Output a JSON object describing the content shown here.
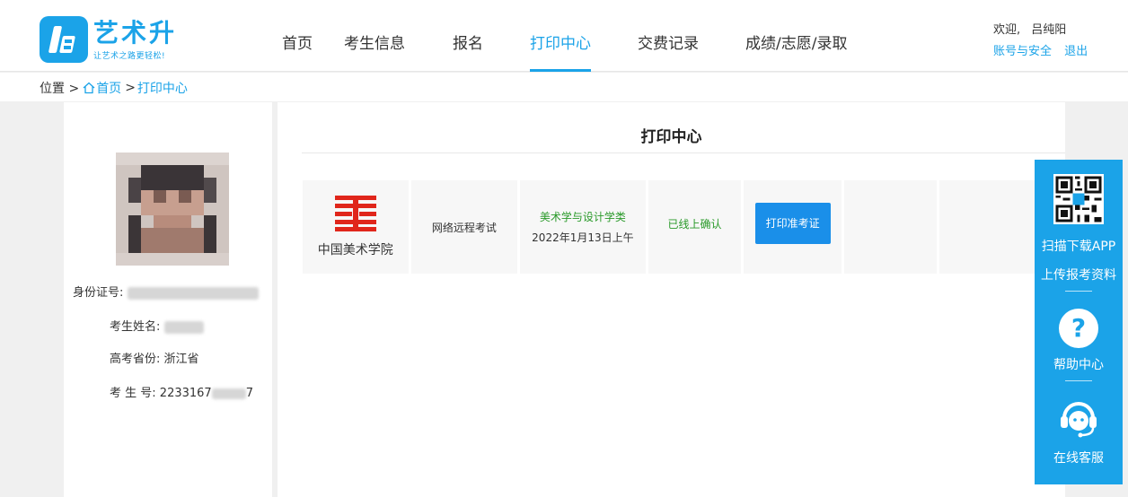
{
  "brand": {
    "name": "艺术升",
    "slogan": "让艺术之路更轻松!"
  },
  "nav": [
    {
      "label": "首页",
      "active": false
    },
    {
      "label": "考生信息",
      "active": false
    },
    {
      "label": "报名",
      "active": false
    },
    {
      "label": "打印中心",
      "active": true
    },
    {
      "label": "交费记录",
      "active": false
    },
    {
      "label": "成绩/志愿/录取",
      "active": false
    }
  ],
  "user": {
    "greeting": "欢迎,",
    "name": "吕纯阳",
    "account_link": "账号与安全",
    "logout_link": "退出"
  },
  "breadcrumb": {
    "prefix": "位置 >",
    "home": "首页",
    "separator": ">",
    "current": "打印中心"
  },
  "profile": {
    "id_label": "身份证号:",
    "name_label": "考生姓名:",
    "province_label": "高考省份:",
    "province": "浙江省",
    "exam_no_label": "考 生 号:",
    "exam_no_visible": "2233167",
    "exam_no_tail": "7"
  },
  "print_center": {
    "title": "打印中心",
    "rows": [
      {
        "school": "中国美术学院",
        "exam_type": "网络远程考试",
        "major": "美术学与设计学类",
        "exam_date": "2022年1月13日上午",
        "status": "已线上确认",
        "action": "打印准考证"
      }
    ]
  },
  "side_float": {
    "scan_label": "扫描下载APP",
    "upload_label": "上传报考资料",
    "help_label": "帮助中心",
    "service_label": "在线客服",
    "help_glyph": "?"
  },
  "colors": {
    "accent": "#1ba3e8",
    "button": "#1a8fe9",
    "status_green": "#2a9a2a",
    "school_red": "#e0261b"
  }
}
